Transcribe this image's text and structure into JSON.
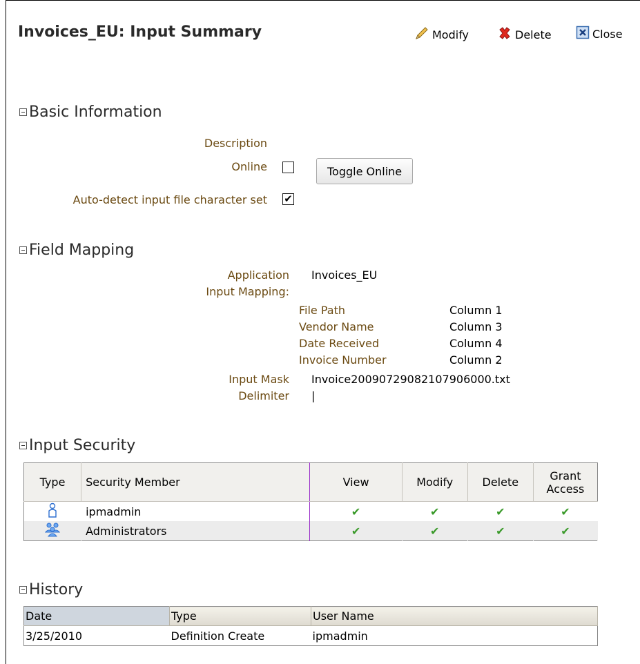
{
  "header": {
    "title": "Invoices_EU: Input Summary",
    "modify_label": "Modify",
    "delete_label": "Delete",
    "close_label": "Close",
    "icons": {
      "modify": "pencil-icon",
      "delete": "red-x-icon",
      "close": "close-box-icon"
    }
  },
  "basic": {
    "title": "Basic Information",
    "description_label": "Description",
    "online_label": "Online",
    "online_checked": false,
    "toggle_button": "Toggle Online",
    "autodetect_label": "Auto-detect input file character set",
    "autodetect_checked": true,
    "autodetect_mark": "✔"
  },
  "mapping": {
    "title": "Field Mapping",
    "application_label": "Application",
    "application_value": "Invoices_EU",
    "input_mapping_label": "Input Mapping:",
    "fields": [
      {
        "name": "File Path",
        "column": "Column 1"
      },
      {
        "name": "Vendor Name",
        "column": "Column 3"
      },
      {
        "name": "Date Received",
        "column": "Column 4"
      },
      {
        "name": "Invoice Number",
        "column": "Column 2"
      }
    ],
    "input_mask_label": "Input Mask",
    "input_mask_value": "Invoice20090729082107906000.txt",
    "delimiter_label": "Delimiter",
    "delimiter_value": "|"
  },
  "security": {
    "title": "Input Security",
    "columns": [
      "Type",
      "Security Member",
      "View",
      "Modify",
      "Delete",
      "Grant Access"
    ],
    "rows": [
      {
        "type_icon": "user-icon",
        "member": "ipmadmin",
        "view": "✔",
        "modify": "✔",
        "delete": "✔",
        "grant": "✔"
      },
      {
        "type_icon": "group-icon",
        "member": "Administrators",
        "view": "✔",
        "modify": "✔",
        "delete": "✔",
        "grant": "✔"
      }
    ],
    "colors": {
      "check": "#3a9a2a",
      "user_icon": "#2d6fd0"
    }
  },
  "history": {
    "title": "History",
    "columns": [
      "Date",
      "Type",
      "User Name"
    ],
    "rows": [
      {
        "date": "3/25/2010",
        "type": "Definition Create",
        "user": "ipmadmin"
      }
    ]
  }
}
